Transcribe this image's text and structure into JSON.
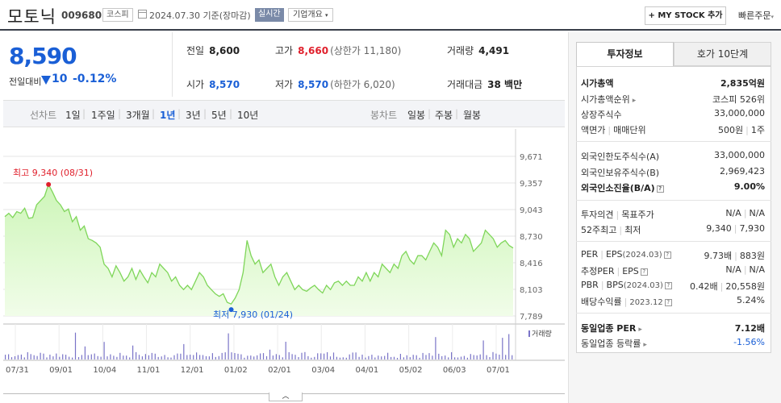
{
  "header": {
    "stock_name": "모토닉",
    "stock_code": "009680",
    "market": "코스피",
    "date": "2024.07.30 기준(장마감)",
    "realtime": "실시간",
    "company_overview": "기업개요",
    "my_stock": "+ MY STOCK 추가",
    "quick_order": "빠른주문"
  },
  "price": {
    "current": "8,590",
    "compare_label": "전일대비",
    "change": "10",
    "change_pct": "-0.12%"
  },
  "quotes": {
    "prev_close_label": "전일",
    "prev_close": "8,600",
    "high_label": "고가",
    "high": "8,660",
    "upper_limit": "(상한가 11,180)",
    "volume_label": "거래량",
    "volume": "4,491",
    "open_label": "시가",
    "open": "8,570",
    "low_label": "저가",
    "low": "8,570",
    "lower_limit": "(하한가 6,020)",
    "amount_label": "거래대금",
    "amount": "38 백만"
  },
  "period_bar": {
    "line_label": "선차트",
    "periods": [
      "1일",
      "1주일",
      "3개월",
      "1년",
      "3년",
      "5년",
      "10년"
    ],
    "selected": "1년",
    "candle_label": "봉차트",
    "candles": [
      "일봉",
      "주봉",
      "월봉"
    ]
  },
  "chart_data": {
    "type": "area",
    "x_ticks": [
      "07/31",
      "09/01",
      "10/04",
      "11/01",
      "12/01",
      "01/02",
      "02/01",
      "03/04",
      "04/01",
      "05/02",
      "06/03",
      "07/01"
    ],
    "y_ticks": [
      "9,671",
      "9,357",
      "9,043",
      "8,730",
      "8,416",
      "8,103",
      "7,789"
    ],
    "ylim": [
      7789,
      9671
    ],
    "series": [
      {
        "values": [
          8960,
          9000,
          8950,
          9020,
          9000,
          9060,
          8940,
          8950,
          9100,
          9150,
          9200,
          9340,
          9250,
          9150,
          9100,
          9020,
          9050,
          8900,
          8960,
          8800,
          8850,
          8700,
          8680,
          8650,
          8600,
          8400,
          8350,
          8250,
          8380,
          8300,
          8200,
          8250,
          8350,
          8220,
          8330,
          8250,
          8180,
          8300,
          8250,
          8400,
          8350,
          8300,
          8200,
          8250,
          8150,
          8100,
          8150,
          8100,
          8200,
          8300,
          8250,
          8150,
          8100,
          8050,
          8020,
          8050,
          7950,
          7930,
          8000,
          8100,
          8300,
          8680,
          8500,
          8400,
          8450,
          8300,
          8350,
          8400,
          8250,
          8150,
          8250,
          8300,
          8200,
          8100,
          8150,
          8100,
          8080,
          8120,
          8150,
          8100,
          8060,
          8150,
          8100,
          8180,
          8200,
          8150,
          8200,
          8150,
          8150,
          8250,
          8200,
          8300,
          8200,
          8300,
          8250,
          8400,
          8350,
          8300,
          8400,
          8350,
          8500,
          8550,
          8450,
          8400,
          8500,
          8500,
          8450,
          8550,
          8650,
          8600,
          8500,
          8800,
          8750,
          8600,
          8700,
          8650,
          8750,
          8700,
          8550,
          8600,
          8650,
          8800,
          8750,
          8700,
          8600,
          8650,
          8680,
          8620,
          8590
        ]
      }
    ],
    "volume_label": "거래량",
    "high_annotation": "최고 9,340 (08/31)",
    "low_annotation": "최저 7,930 (01/24)"
  },
  "right_panel": {
    "tabs": [
      "투자정보",
      "호가 10단계"
    ],
    "market_cap_label": "시가총액",
    "market_cap": "2,835억원",
    "rank_label": "시가총액순위",
    "rank": "코스피 526위",
    "shares_label": "상장주식수",
    "shares": "33,000,000",
    "par_label": "액면가",
    "trade_unit_label": "매매단위",
    "par": "500원",
    "trade_unit": "1주",
    "foreign_limit_label": "외국인한도주식수(A)",
    "foreign_limit": "33,000,000",
    "foreign_own_label": "외국인보유주식수(B)",
    "foreign_own": "2,969,423",
    "foreign_rate_label": "외국인소진율(B/A)",
    "foreign_rate": "9.00%",
    "opinion_label": "투자의견",
    "target_label": "목표주가",
    "opinion": "N/A",
    "target": "N/A",
    "w52_label": "52주최고",
    "w52_low_label": "최저",
    "w52_high": "9,340",
    "w52_low": "7,930",
    "per_label": "PER",
    "eps_label": "EPS",
    "eps_period": "(2024.03)",
    "per": "9.73배",
    "eps": "883원",
    "est_per_label": "추정PER",
    "est_eps_label": "EPS",
    "est_per": "N/A",
    "est_eps": "N/A",
    "pbr_label": "PBR",
    "bps_label": "BPS",
    "bps_period": "(2024.03)",
    "pbr": "0.42배",
    "bps": "20,558원",
    "div_label": "배당수익률",
    "div_period": "2023.12",
    "div": "5.24%",
    "ind_per_label": "동일업종 PER",
    "ind_per": "7.12배",
    "ind_chg_label": "동일업종 등락률",
    "ind_chg": "-1.56%"
  }
}
